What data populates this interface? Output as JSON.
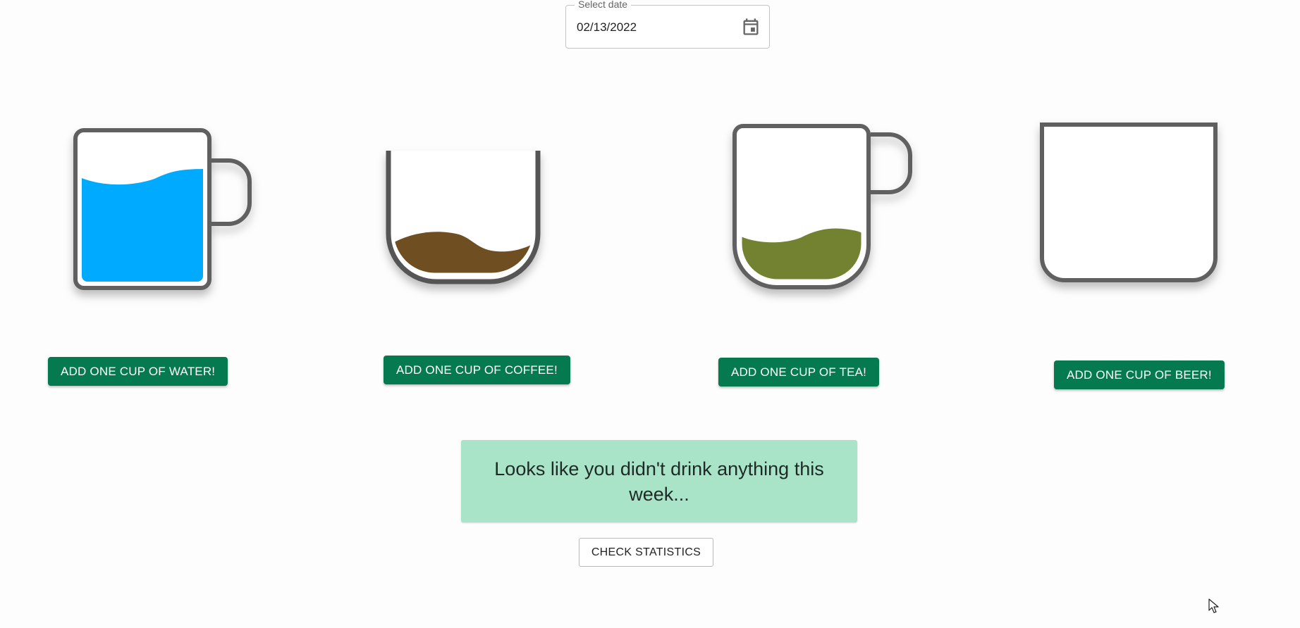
{
  "date_picker": {
    "label": "Select date",
    "value": "02/13/2022",
    "icon": "calendar-icon"
  },
  "drinks": [
    {
      "name": "water",
      "button_label": "ADD ONE CUP OF WATER!",
      "fill_color": "#00aaff",
      "fill_level": 0.7
    },
    {
      "name": "coffee",
      "button_label": "ADD ONE CUP OF COFFEE!",
      "fill_color": "#6f4e22",
      "fill_level": 0.33
    },
    {
      "name": "tea",
      "button_label": "ADD ONE CUP OF TEA!",
      "fill_color": "#728230",
      "fill_level": 0.3
    },
    {
      "name": "beer",
      "button_label": "ADD ONE CUP OF BEER!",
      "fill_color": "#e0a000",
      "fill_level": 0.0
    }
  ],
  "message": "Looks like you didn't drink anything this week...",
  "statistics_button_label": "CHECK STATISTICS",
  "colors": {
    "primary_button": "#05794f",
    "message_background": "#a9e4c9",
    "cup_outline": "#616161"
  }
}
